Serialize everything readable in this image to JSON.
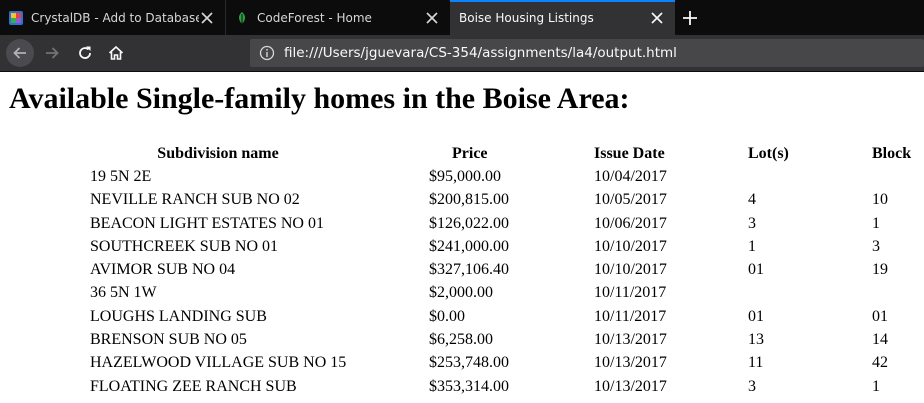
{
  "browser": {
    "tabs": [
      {
        "title": "CrystalDB - Add to Database",
        "favicon": "crystaldb-favicon",
        "active": false
      },
      {
        "title": "CodeForest - Home",
        "favicon": "codeforest-leaf-favicon",
        "active": false
      },
      {
        "title": "Boise Housing Listings",
        "favicon": "",
        "active": true
      }
    ],
    "url": "file:///Users/jguevara/CS-354/assignments/la4/output.html",
    "icons": {
      "back": "back-arrow-icon",
      "forward": "forward-arrow-icon",
      "reload": "reload-icon",
      "home": "home-icon",
      "info": "info-icon",
      "close": "close-icon",
      "new_tab": "plus-icon"
    },
    "colors": {
      "tabbar": "#0c0c0d",
      "active_tab": "#323234",
      "active_tab_accent": "#0a84ff",
      "toolbar": "#323234",
      "urlbar": "#474749"
    }
  },
  "page": {
    "title": "Available Single-family homes in the Boise Area:",
    "columns": [
      "Subdivision name",
      "Price",
      "Issue Date",
      "Lot(s)",
      "Block"
    ],
    "rows": [
      {
        "subdivision": "19 5N 2E",
        "price": "$95,000.00",
        "issue_date": "10/04/2017",
        "lots": "",
        "block": ""
      },
      {
        "subdivision": "NEVILLE RANCH SUB NO 02",
        "price": "$200,815.00",
        "issue_date": "10/05/2017",
        "lots": "4",
        "block": "10"
      },
      {
        "subdivision": "BEACON LIGHT ESTATES NO 01",
        "price": "$126,022.00",
        "issue_date": "10/06/2017",
        "lots": "3",
        "block": "1"
      },
      {
        "subdivision": "SOUTHCREEK SUB NO 01",
        "price": "$241,000.00",
        "issue_date": "10/10/2017",
        "lots": "1",
        "block": "3"
      },
      {
        "subdivision": "AVIMOR SUB NO 04",
        "price": "$327,106.40",
        "issue_date": "10/10/2017",
        "lots": "01",
        "block": "19"
      },
      {
        "subdivision": "36 5N 1W",
        "price": "$2,000.00",
        "issue_date": "10/11/2017",
        "lots": "",
        "block": ""
      },
      {
        "subdivision": "LOUGHS LANDING SUB",
        "price": "$0.00",
        "issue_date": "10/11/2017",
        "lots": "01",
        "block": "01"
      },
      {
        "subdivision": "BRENSON SUB NO 05",
        "price": "$6,258.00",
        "issue_date": "10/13/2017",
        "lots": "13",
        "block": "14"
      },
      {
        "subdivision": "HAZELWOOD VILLAGE SUB NO 15",
        "price": "$253,748.00",
        "issue_date": "10/13/2017",
        "lots": "11",
        "block": "42"
      },
      {
        "subdivision": "FLOATING ZEE RANCH SUB",
        "price": "$353,314.00",
        "issue_date": "10/13/2017",
        "lots": "3",
        "block": "1"
      }
    ]
  }
}
